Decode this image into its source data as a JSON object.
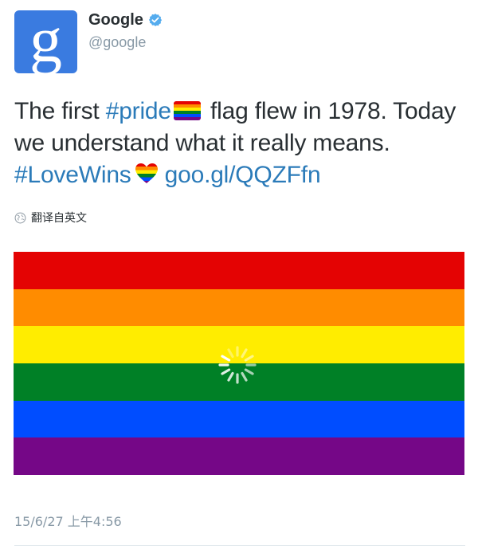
{
  "account": {
    "name": "Google",
    "handle": "@google",
    "avatar_letter": "g",
    "avatar_color": "#3a7be0",
    "verified": true
  },
  "tweet": {
    "text_1": "The first ",
    "hashtag_pride": "#pride",
    "text_2": " flag flew in 1978. Today we understand what it really means. ",
    "hashtag_lovewins": "#LoveWins",
    "link": "goo.gl/QQZFfn",
    "link_color": "#2b7bb9"
  },
  "translate": {
    "label": "翻译自英文",
    "icon": "globe-icon"
  },
  "media": {
    "stripe_colors": [
      "#e40303",
      "#ff8c00",
      "#ffed00",
      "#008026",
      "#004dff",
      "#750787"
    ],
    "loading_icon": "spinner-icon"
  },
  "timestamp": "15/6/27 上午4:56"
}
